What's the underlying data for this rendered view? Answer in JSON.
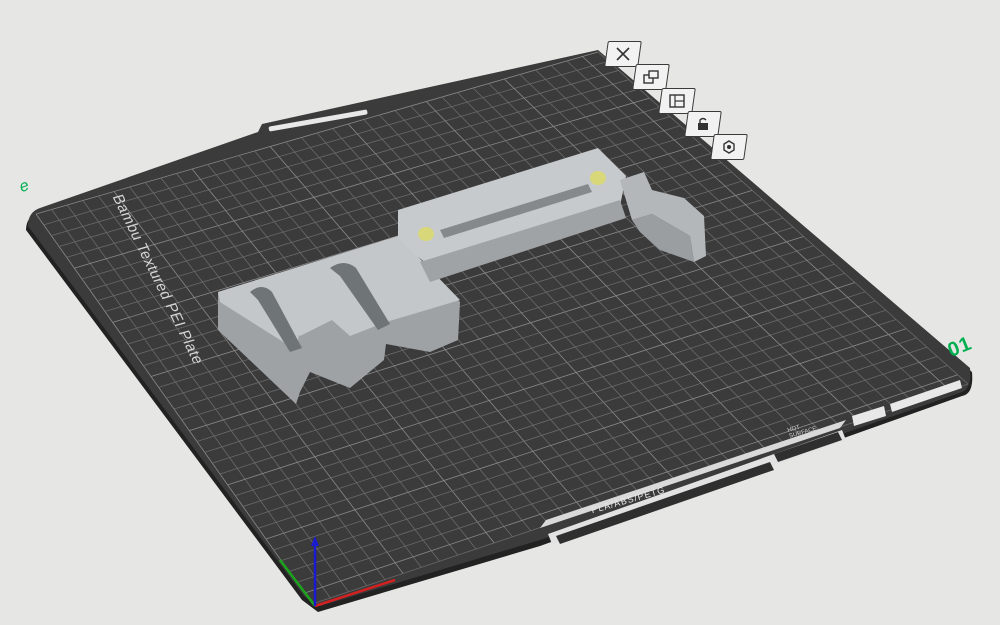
{
  "plate": {
    "name": "Bambu Textured PEI Plate",
    "number": "01",
    "mark": "e",
    "filament_label": "PLA/ABS/PETG",
    "surface_label": "HOT\nSURFACE"
  },
  "toolbar": [
    {
      "id": "remove-plate",
      "icon": "close-icon"
    },
    {
      "id": "arrange",
      "icon": "arrange-icon"
    },
    {
      "id": "layout",
      "icon": "layout-icon"
    },
    {
      "id": "lock",
      "icon": "lock-icon"
    },
    {
      "id": "settings",
      "icon": "gear-icon"
    }
  ],
  "colors": {
    "background": "#e6e6e4",
    "plate": "#3b3b3b",
    "grid": "#6a6a6a",
    "model": "#b9bdbf",
    "accent": "#00b050",
    "axis_x": "#d32020",
    "axis_y": "#1ca31c",
    "axis_z": "#1a1ad0"
  }
}
